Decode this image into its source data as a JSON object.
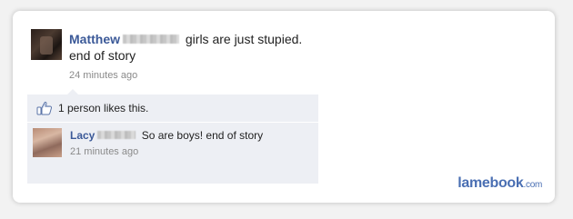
{
  "post": {
    "author_first_name": "Matthew",
    "message": "girls are just stupied. end of story",
    "timestamp": "24 minutes ago"
  },
  "likes": {
    "text": "1 person likes this.",
    "icon": "thumbs-up-icon"
  },
  "comment": {
    "author_first_name": "Lacy",
    "message": "So are boys! end of story",
    "timestamp": "21 minutes ago"
  },
  "watermark": {
    "brand": "lamebook",
    "tld": ".com"
  },
  "colors": {
    "name_link": "#3b5998",
    "feedback_bg": "#edeff4",
    "timestamp": "#8a8a8a",
    "watermark": "#4a6fb3"
  }
}
